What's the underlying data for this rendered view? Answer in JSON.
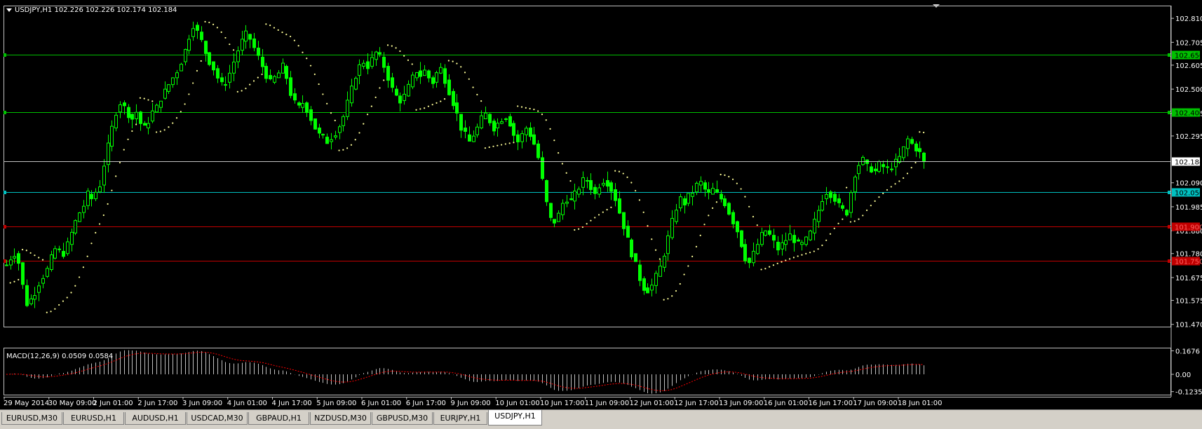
{
  "chart_header": {
    "symbol_line": "USDJPY,H1  102.226 102.226 102.174 102.184",
    "dropdown_icon": "triangle-down-icon"
  },
  "indicator_header": "MACD(12,26,9) 0.0509 0.0584",
  "colors": {
    "background": "#000000",
    "candle": "#00ff00",
    "sar": "#ffff99",
    "grid": "#ffffff",
    "green_level": "#00c000",
    "cyan_level": "#00c0c0",
    "red_level": "#c00000",
    "macd_hist": "#c0c0c0",
    "macd_signal": "#ff0000"
  },
  "price_axis": {
    "labels": [
      "102.810",
      "102.705",
      "102.605",
      "102.500",
      "102.395",
      "102.295",
      "102.090",
      "101.985",
      "101.880",
      "101.780",
      "101.675",
      "101.575",
      "101.470"
    ],
    "current_price_label": "102.184",
    "min": 101.46,
    "max": 102.835
  },
  "macd_axis": {
    "labels": [
      "0.1676",
      "0.00",
      "-0.1235"
    ],
    "min": -0.145,
    "max": 0.185
  },
  "levels": [
    {
      "price": 102.65,
      "label": "102.650",
      "kind": "green"
    },
    {
      "price": 102.4,
      "label": "102.400",
      "kind": "green"
    },
    {
      "price": 102.05,
      "label": "102.050",
      "kind": "cyan"
    },
    {
      "price": 101.9,
      "label": "101.900",
      "kind": "red"
    },
    {
      "price": 101.75,
      "label": "101.750",
      "kind": "red"
    }
  ],
  "time_axis": {
    "labels": [
      "29 May 2014",
      "30 May 09:00",
      "2 Jun 01:00",
      "2 Jun 17:00",
      "3 Jun 09:00",
      "4 Jun 01:00",
      "4 Jun 17:00",
      "5 Jun 09:00",
      "6 Jun 01:00",
      "6 Jun 17:00",
      "9 Jun 09:00",
      "10 Jun 01:00",
      "10 Jun 17:00",
      "11 Jun 09:00",
      "12 Jun 01:00",
      "12 Jun 17:00",
      "13 Jun 09:00",
      "16 Jun 01:00",
      "16 Jun 17:00",
      "17 Jun 09:00",
      "18 Jun 01:00"
    ]
  },
  "tabs": [
    {
      "label": "EURUSD,M30",
      "active": false
    },
    {
      "label": "EURUSD,H1",
      "active": false
    },
    {
      "label": "AUDUSD,H1",
      "active": false
    },
    {
      "label": "USDCAD,M30",
      "active": false
    },
    {
      "label": "GBPAUD,H1",
      "active": false
    },
    {
      "label": "NZDUSD,M30",
      "active": false
    },
    {
      "label": "GBPUSD,M30",
      "active": false
    },
    {
      "label": "EURJPY,H1",
      "active": false
    },
    {
      "label": "USDJPY,H1",
      "active": true
    }
  ],
  "chart_data": {
    "type": "candlestick",
    "symbol": "USDJPY",
    "timeframe": "H1",
    "price_path": [
      101.73,
      101.76,
      101.78,
      101.74,
      101.64,
      101.56,
      101.58,
      101.61,
      101.65,
      101.68,
      101.71,
      101.76,
      101.8,
      101.79,
      101.78,
      101.82,
      101.87,
      101.92,
      101.96,
      101.99,
      102.04,
      102.02,
      102.05,
      102.08,
      102.17,
      102.25,
      102.33,
      102.4,
      102.44,
      102.42,
      102.39,
      102.37,
      102.4,
      102.35,
      102.33,
      102.36,
      102.4,
      102.42,
      102.46,
      102.49,
      102.52,
      102.55,
      102.58,
      102.62,
      102.67,
      102.73,
      102.78,
      102.75,
      102.71,
      102.66,
      102.62,
      102.59,
      102.55,
      102.52,
      102.53,
      102.57,
      102.62,
      102.67,
      102.71,
      102.74,
      102.72,
      102.68,
      102.64,
      102.6,
      102.56,
      102.53,
      102.55,
      102.57,
      102.6,
      102.55,
      102.48,
      102.44,
      102.42,
      102.44,
      102.41,
      102.37,
      102.33,
      102.3,
      102.29,
      102.27,
      102.29,
      102.31,
      102.34,
      102.38,
      102.44,
      102.5,
      102.56,
      102.6,
      102.62,
      102.6,
      102.63,
      102.66,
      102.64,
      102.6,
      102.55,
      102.5,
      102.47,
      102.45,
      102.47,
      102.51,
      102.55,
      102.58,
      102.56,
      102.58,
      102.55,
      102.53,
      102.57,
      102.59,
      102.54,
      102.49,
      102.44,
      102.39,
      102.33,
      102.3,
      102.27,
      102.3,
      102.33,
      102.37,
      102.39,
      102.36,
      102.33,
      102.35,
      102.37,
      102.38,
      102.35,
      102.3,
      102.27,
      102.3,
      102.33,
      102.3,
      102.26,
      102.2,
      102.1,
      102.0,
      101.93,
      101.92,
      101.95,
      102.0,
      102.02,
      102.01,
      102.04,
      102.07,
      102.1,
      102.1,
      102.07,
      102.04,
      102.08,
      102.1,
      102.09,
      102.06,
      102.02,
      101.96,
      101.9,
      101.84,
      101.78,
      101.73,
      101.67,
      101.63,
      101.62,
      101.64,
      101.68,
      101.72,
      101.78,
      101.85,
      101.92,
      101.98,
      102.02,
      102.0,
      102.03,
      102.05,
      102.08,
      102.09,
      102.06,
      102.04,
      102.06,
      102.04,
      102.02,
      102.0,
      101.96,
      101.92,
      101.88,
      101.82,
      101.76,
      101.74,
      101.78,
      101.82,
      101.86,
      101.88,
      101.86,
      101.83,
      101.8,
      101.82,
      101.84,
      101.86,
      101.84,
      101.82,
      101.82,
      101.84,
      101.87,
      101.92,
      101.97,
      102.02,
      102.05,
      102.04,
      102.02,
      101.99,
      101.97,
      101.96,
      102.05,
      102.13,
      102.17,
      102.19,
      102.16,
      102.15,
      102.14,
      102.17,
      102.16,
      102.15,
      102.16,
      102.18,
      102.2,
      102.24,
      102.28,
      102.26,
      102.24,
      102.22,
      102.18
    ]
  }
}
